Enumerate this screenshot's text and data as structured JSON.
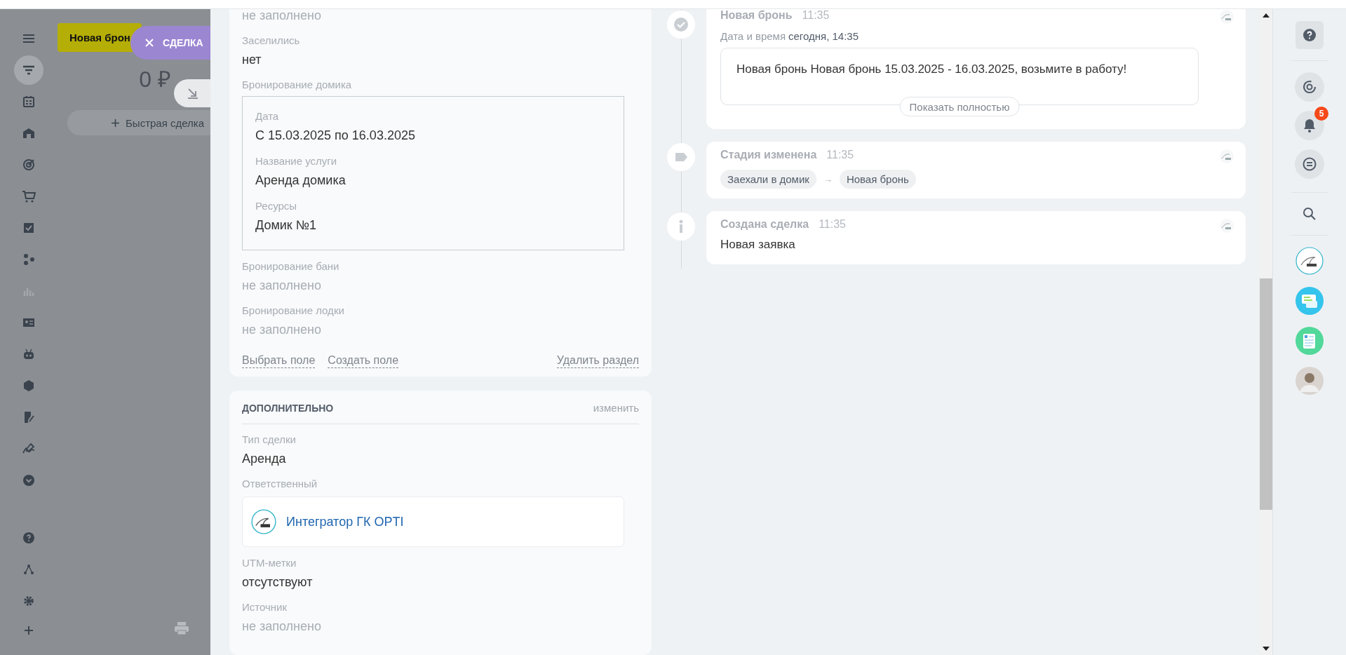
{
  "backdrop": {
    "deal_tag": "Новая брон",
    "close_tab": "СДЕЛКА",
    "amount": "0 ₽",
    "quick_deal": "Быстрая сделка",
    "nav": [
      {
        "selected": false
      },
      {
        "selected": true
      },
      {
        "selected": false
      },
      {
        "selected": false
      },
      {
        "selected": false
      },
      {
        "selected": false
      },
      {
        "selected": false
      },
      {
        "selected": false
      },
      {
        "selected": false
      },
      {
        "selected": false
      },
      {
        "selected": false
      },
      {
        "selected": false
      },
      {
        "selected": false
      },
      {
        "selected": false
      },
      {
        "selected": false
      },
      {
        "selected": false
      },
      {
        "selected": false
      },
      {
        "selected": false
      }
    ]
  },
  "main_section": {
    "fields": [
      {
        "kind": "text",
        "value": "не заполнено",
        "empty": true
      },
      {
        "kind": "text",
        "label": "Заселились",
        "value": "нет",
        "empty": false
      },
      {
        "kind": "group",
        "label": "Бронирование домика",
        "subfields": [
          {
            "label": "Дата",
            "value": "С 15.03.2025 по 16.03.2025"
          },
          {
            "label": "Название услуги",
            "value": "Аренда домика"
          },
          {
            "label": "Ресурсы",
            "value": "Домик №1"
          }
        ]
      },
      {
        "kind": "text",
        "label": "Бронирование бани",
        "value": "не заполнено",
        "empty": true
      },
      {
        "kind": "text",
        "label": "Бронирование лодки",
        "value": "не заполнено",
        "empty": true
      }
    ],
    "actions": [
      "Выбрать поле",
      "Создать поле"
    ],
    "delete_action": "Удалить раздел"
  },
  "extra_section": {
    "title": "ДОПОЛНИТЕЛЬНО",
    "edit": "изменить",
    "fields": [
      {
        "kind": "text",
        "label": "Тип сделки",
        "value": "Аренда",
        "empty": false
      },
      {
        "kind": "user",
        "label": "Ответственный",
        "value": "Интегратор ГК OPTI"
      },
      {
        "kind": "text",
        "label": "UTM-метки",
        "value": "отсутствуют",
        "empty": false
      },
      {
        "kind": "text",
        "label": "Источник",
        "value": "не заполнено",
        "empty": true
      }
    ]
  },
  "timeline": [
    {
      "kind": "notification",
      "title": "Новая бронь",
      "time": "11:35",
      "date_label": "Дата и время",
      "date_value": "сегодня, 14:35",
      "message": "Новая бронь Новая бронь 15.03.2025 - 16.03.2025, возьмите в работу!",
      "button": "Показать полностью"
    },
    {
      "kind": "stage",
      "title": "Стадия изменена",
      "time": "11:35",
      "from": "Заехали в домик",
      "arrow": "→",
      "to": "Новая бронь"
    },
    {
      "kind": "created",
      "title": "Создана сделка",
      "time": "11:35",
      "text": "Новая заявка"
    }
  ],
  "right_bar": {
    "notification_count": "5"
  }
}
